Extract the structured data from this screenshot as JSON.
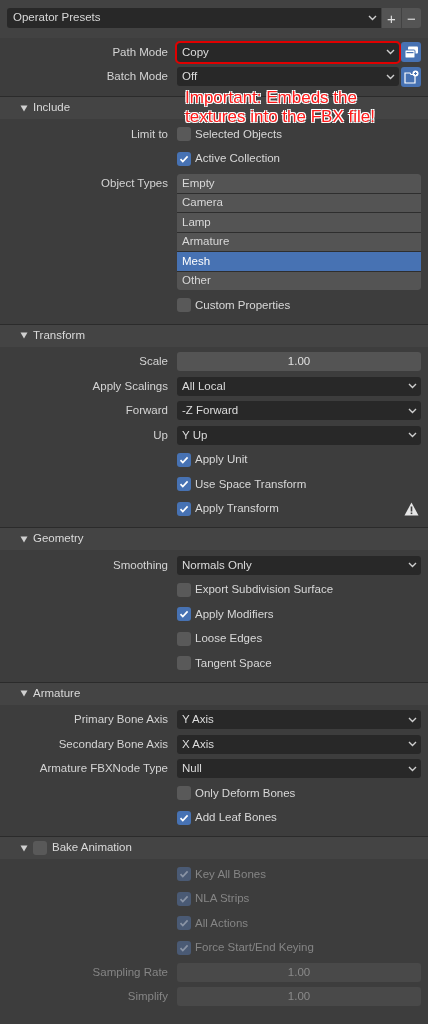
{
  "presets": {
    "value": "Operator Presets",
    "add": "+",
    "remove": "−"
  },
  "main_rows": [
    {
      "kind": "dropdown_pack",
      "label": "Path Mode",
      "value": "Copy",
      "highlighted": true
    },
    {
      "kind": "dropdown_new",
      "label": "Batch Mode",
      "value": "Off",
      "highlighted": false
    }
  ],
  "annotation": "Important: Embeds the textures into the FBX file!",
  "sections": [
    {
      "title": "Include",
      "expanded": true,
      "rows": [
        {
          "kind": "checkbox",
          "label": "Limit to",
          "text": "Selected Objects",
          "checked": false,
          "disabled": false
        },
        {
          "kind": "checkbox",
          "text": "Active Collection",
          "checked": true,
          "disabled": false
        },
        {
          "kind": "listbox",
          "label": "Object Types",
          "items": [
            {
              "label": "Empty",
              "selected": false
            },
            {
              "label": "Camera",
              "selected": false
            },
            {
              "label": "Lamp",
              "selected": false
            },
            {
              "label": "Armature",
              "selected": false
            },
            {
              "label": "Mesh",
              "selected": true
            },
            {
              "label": "Other",
              "selected": false
            }
          ]
        },
        {
          "kind": "checkbox",
          "text": "Custom Properties",
          "checked": false,
          "disabled": false
        }
      ]
    },
    {
      "title": "Transform",
      "expanded": true,
      "rows": [
        {
          "kind": "number",
          "label": "Scale",
          "value": "1.00",
          "disabled": false
        },
        {
          "kind": "dropdown",
          "label": "Apply Scalings",
          "value": "All Local",
          "disabled": false
        },
        {
          "kind": "dropdown",
          "label": "Forward",
          "value": "-Z Forward",
          "disabled": false
        },
        {
          "kind": "dropdown",
          "label": "Up",
          "value": "Y Up",
          "disabled": false
        },
        {
          "kind": "checkbox",
          "text": "Apply Unit",
          "checked": true,
          "disabled": false
        },
        {
          "kind": "checkbox",
          "text": "Use Space Transform",
          "checked": true,
          "disabled": false
        },
        {
          "kind": "checkbox",
          "text": "Apply Transform",
          "checked": true,
          "disabled": false,
          "warning": true
        }
      ]
    },
    {
      "title": "Geometry",
      "expanded": true,
      "rows": [
        {
          "kind": "dropdown",
          "label": "Smoothing",
          "value": "Normals Only",
          "disabled": false
        },
        {
          "kind": "checkbox",
          "text": "Export Subdivision Surface",
          "checked": false,
          "disabled": false
        },
        {
          "kind": "checkbox",
          "text": "Apply Modifiers",
          "checked": true,
          "disabled": false
        },
        {
          "kind": "checkbox",
          "text": "Loose Edges",
          "checked": false,
          "disabled": false
        },
        {
          "kind": "checkbox",
          "text": "Tangent Space",
          "checked": false,
          "disabled": false
        }
      ]
    },
    {
      "title": "Armature",
      "expanded": true,
      "rows": [
        {
          "kind": "dropdown",
          "label": "Primary Bone Axis",
          "value": "Y Axis",
          "disabled": false
        },
        {
          "kind": "dropdown",
          "label": "Secondary Bone Axis",
          "value": "X Axis",
          "disabled": false
        },
        {
          "kind": "dropdown",
          "label": "Armature FBXNode Type",
          "value": "Null",
          "disabled": false
        },
        {
          "kind": "checkbox",
          "text": "Only Deform Bones",
          "checked": false,
          "disabled": false
        },
        {
          "kind": "checkbox",
          "text": "Add Leaf Bones",
          "checked": true,
          "disabled": false
        }
      ]
    },
    {
      "title": "Bake Animation",
      "expanded": true,
      "checked": false,
      "rows": [
        {
          "kind": "checkbox",
          "text": "Key All Bones",
          "checked": true,
          "disabled": true
        },
        {
          "kind": "checkbox",
          "text": "NLA Strips",
          "checked": true,
          "disabled": true
        },
        {
          "kind": "checkbox",
          "text": "All Actions",
          "checked": true,
          "disabled": true
        },
        {
          "kind": "checkbox",
          "text": "Force Start/End Keying",
          "checked": true,
          "disabled": true
        },
        {
          "kind": "number",
          "label": "Sampling Rate",
          "value": "1.00",
          "disabled": true
        },
        {
          "kind": "number",
          "label": "Simplify",
          "value": "1.00",
          "disabled": true
        }
      ]
    }
  ]
}
